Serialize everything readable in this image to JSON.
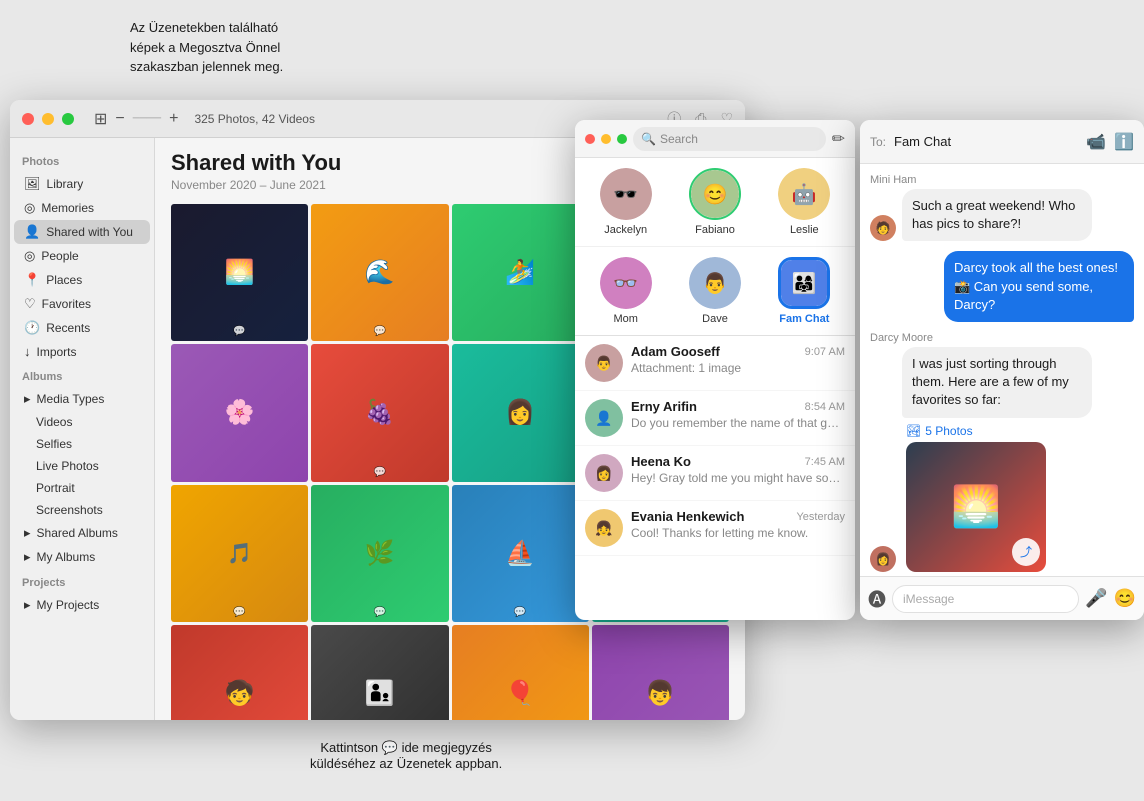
{
  "annotation": {
    "top": "Az Üzenetekben található\nképek a Megosztva Önnel\nszakaszban jelennek meg.",
    "bottom": "Kattintson 💬 ide megjegyzés\nküldéséhez az Üzenetek appban."
  },
  "photos_app": {
    "title": "Photos",
    "photo_count": "325 Photos, 42 Videos",
    "sidebar": {
      "section_library": "Library",
      "items_top": [
        {
          "label": "Library",
          "icon": "🖼"
        },
        {
          "label": "Memories",
          "icon": "◎"
        },
        {
          "label": "Shared with You",
          "icon": "👤",
          "active": true
        },
        {
          "label": "People",
          "icon": "◎"
        },
        {
          "label": "Places",
          "icon": "📍"
        },
        {
          "label": "Favorites",
          "icon": "♡"
        },
        {
          "label": "Recents",
          "icon": "🕐"
        },
        {
          "label": "Imports",
          "icon": "↓"
        }
      ],
      "albums_section": "Albums",
      "albums_items": [
        {
          "label": "Media Types",
          "icon": "▸□"
        },
        {
          "label": "Videos",
          "icon": "□□"
        },
        {
          "label": "Selfies",
          "icon": "🤳"
        },
        {
          "label": "Live Photos",
          "icon": "◎"
        },
        {
          "label": "Portrait",
          "icon": "◎"
        },
        {
          "label": "Screenshots",
          "icon": "📸"
        },
        {
          "label": "Shared Albums",
          "icon": "▸□"
        },
        {
          "label": "My Albums",
          "icon": "▸□"
        }
      ],
      "projects_section": "Projects",
      "projects_items": [
        {
          "label": "My Projects",
          "icon": "▸□"
        }
      ]
    },
    "content": {
      "title": "Shared with You",
      "date_range": "November 2020 – June 2021"
    }
  },
  "messages_app": {
    "search_placeholder": "Search",
    "compose_icon": "✏",
    "pinned_contacts": [
      {
        "name": "Jackelyn",
        "emoji": "🕶",
        "bg": "#c8a0a0"
      },
      {
        "name": "Fabiano",
        "emoji": "😊",
        "bg": "#a8c890"
      },
      {
        "name": "Leslie",
        "emoji": "🤖",
        "bg": "#f0d080"
      },
      {
        "name": "Mom",
        "emoji": "👓",
        "bg": "#d080c0"
      },
      {
        "name": "Dave",
        "emoji": "👨",
        "bg": "#a0b8d8"
      },
      {
        "name": "Fam Chat",
        "emoji": "👨‍👩",
        "bg": "#5080e8",
        "active": true
      }
    ],
    "conversations": [
      {
        "name": "Adam Gooseff",
        "time": "9:07 AM",
        "preview": "Attachment: 1 image",
        "avatar_emoji": "👨",
        "avatar_bg": "#c8a0a0"
      },
      {
        "name": "Erny Arifin",
        "time": "8:54 AM",
        "preview": "Do you remember the name of that guy from brunch?",
        "avatar_emoji": "👤",
        "avatar_bg": "#80c0a0"
      },
      {
        "name": "Heena Ko",
        "time": "7:45 AM",
        "preview": "Hey! Gray told me you might have some good recommendations for our...",
        "avatar_emoji": "👩",
        "avatar_bg": "#d0a8c0"
      },
      {
        "name": "Evania Henkewich",
        "time": "Yesterday",
        "preview": "Cool! Thanks for letting me know.",
        "avatar_emoji": "👧",
        "avatar_bg": "#f0c870"
      }
    ]
  },
  "chat_window": {
    "to_label": "To:",
    "recipient": "Fam Chat",
    "video_icon": "📹",
    "info_icon": "ℹ",
    "messages": [
      {
        "sender": "Mini Ham",
        "direction": "incoming",
        "text": "Such a great weekend! Who has pics to share?!",
        "avatar_emoji": "🧑",
        "avatar_bg": "#d08060"
      },
      {
        "direction": "outgoing",
        "text": "Darcy took all the best ones! 📸 Can you send some, Darcy?"
      },
      {
        "sender": "Darcy Moore",
        "direction": "incoming",
        "text": "I was just sorting through them. Here are a few of my favorites so far:",
        "avatar_emoji": "👩",
        "avatar_bg": "#c07060"
      }
    ],
    "photos_badge": "5 Photos",
    "input_placeholder": "iMessage",
    "app_icon": "🅐",
    "audio_icon": "🎤",
    "emoji_icon": "😊"
  },
  "colors": {
    "blue_bubble": "#1a73e8",
    "imessage_blue": "#007AFF"
  }
}
